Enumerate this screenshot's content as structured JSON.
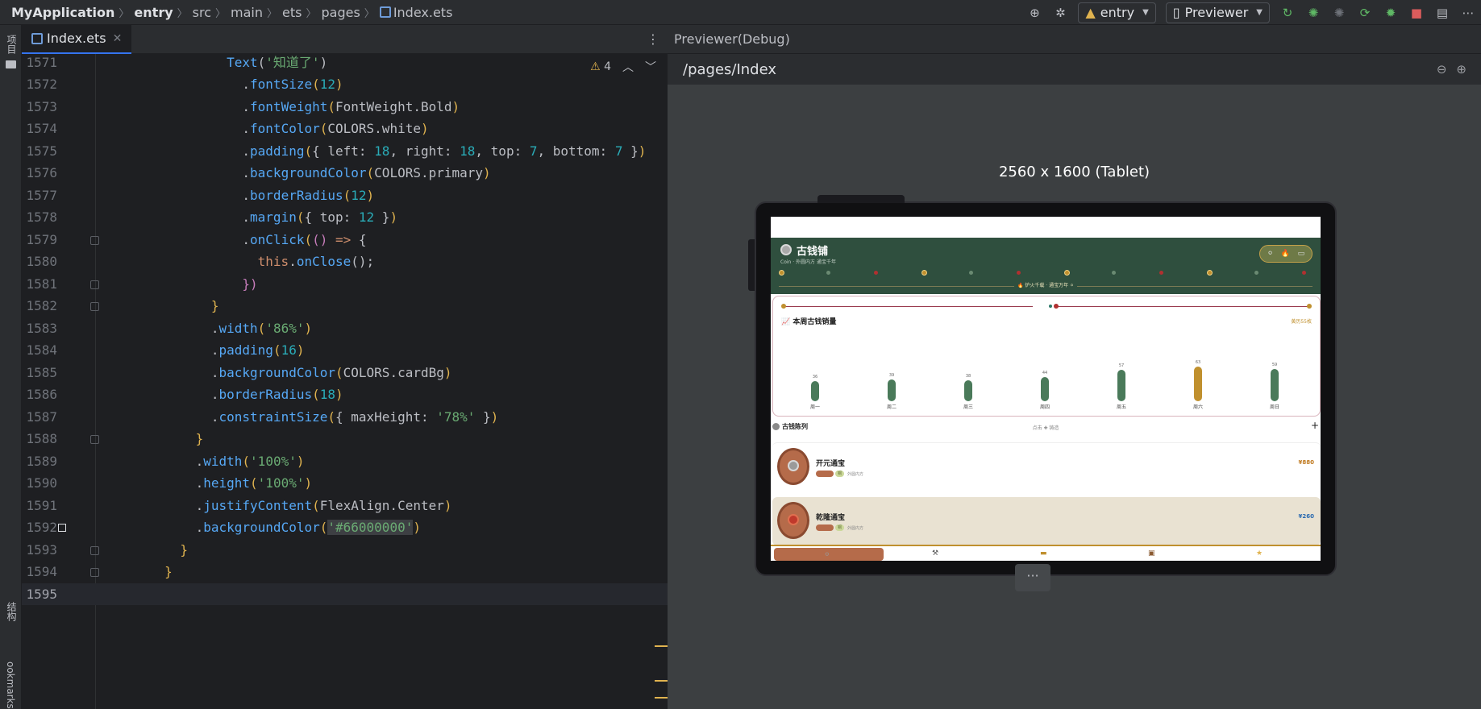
{
  "breadcrumb": [
    "MyApplication",
    "entry",
    "src",
    "main",
    "ets",
    "pages",
    "Index.ets"
  ],
  "toolbar": {
    "module_combo": "entry",
    "previewer_combo": "Previewer"
  },
  "left_strip": {
    "project_label": "项目",
    "structure_label": "结构",
    "bookmarks_label": "ookmarks"
  },
  "editor": {
    "tab_label": "Index.ets",
    "warning_count": "4",
    "lines": [
      {
        "n": "1571",
        "tokens": [
          [
            "w",
            "                "
          ],
          [
            "f",
            "Text"
          ],
          [
            "w",
            "("
          ],
          [
            "s",
            "'知道了'"
          ],
          [
            "w",
            ")"
          ]
        ]
      },
      {
        "n": "1572",
        "tokens": [
          [
            "w",
            "                  ."
          ],
          [
            "f",
            "fontSize"
          ],
          [
            "y",
            "("
          ],
          [
            "n",
            "12"
          ],
          [
            "y",
            ")"
          ]
        ]
      },
      {
        "n": "1573",
        "tokens": [
          [
            "w",
            "                  ."
          ],
          [
            "f",
            "fontWeight"
          ],
          [
            "y",
            "("
          ],
          [
            "w",
            "FontWeight.Bold"
          ],
          [
            "y",
            ")"
          ]
        ]
      },
      {
        "n": "1574",
        "tokens": [
          [
            "w",
            "                  ."
          ],
          [
            "f",
            "fontColor"
          ],
          [
            "y",
            "("
          ],
          [
            "w",
            "COLORS.white"
          ],
          [
            "y",
            ")"
          ]
        ]
      },
      {
        "n": "1575",
        "tokens": [
          [
            "w",
            "                  ."
          ],
          [
            "f",
            "padding"
          ],
          [
            "y",
            "("
          ],
          [
            "w",
            "{ left: "
          ],
          [
            "n",
            "18"
          ],
          [
            "w",
            ", right: "
          ],
          [
            "n",
            "18"
          ],
          [
            "w",
            ", top: "
          ],
          [
            "n",
            "7"
          ],
          [
            "w",
            ", bottom: "
          ],
          [
            "n",
            "7"
          ],
          [
            "w",
            " }"
          ],
          [
            "y",
            ")"
          ]
        ]
      },
      {
        "n": "1576",
        "tokens": [
          [
            "w",
            "                  ."
          ],
          [
            "f",
            "backgroundColor"
          ],
          [
            "y",
            "("
          ],
          [
            "w",
            "COLORS.primary"
          ],
          [
            "y",
            ")"
          ]
        ]
      },
      {
        "n": "1577",
        "tokens": [
          [
            "w",
            "                  ."
          ],
          [
            "f",
            "borderRadius"
          ],
          [
            "y",
            "("
          ],
          [
            "n",
            "12"
          ],
          [
            "y",
            ")"
          ]
        ]
      },
      {
        "n": "1578",
        "tokens": [
          [
            "w",
            "                  ."
          ],
          [
            "f",
            "margin"
          ],
          [
            "y",
            "("
          ],
          [
            "w",
            "{ top: "
          ],
          [
            "n",
            "12"
          ],
          [
            "w",
            " }"
          ],
          [
            "y",
            ")"
          ]
        ]
      },
      {
        "n": "1579",
        "tokens": [
          [
            "w",
            "                  ."
          ],
          [
            "f",
            "onClick"
          ],
          [
            "y",
            "("
          ],
          [
            "p",
            "()"
          ],
          [
            "w",
            " "
          ],
          [
            "k",
            "=>"
          ],
          [
            "w",
            " {"
          ]
        ]
      },
      {
        "n": "1580",
        "tokens": [
          [
            "w",
            "                    "
          ],
          [
            "k",
            "this"
          ],
          [
            "w",
            "."
          ],
          [
            "f",
            "onClose"
          ],
          [
            "w",
            "();"
          ]
        ]
      },
      {
        "n": "1581",
        "tokens": [
          [
            "w",
            "                  "
          ],
          [
            "p",
            "})"
          ]
        ]
      },
      {
        "n": "1582",
        "tokens": [
          [
            "w",
            "              "
          ],
          [
            "y",
            "}"
          ]
        ]
      },
      {
        "n": "1583",
        "tokens": [
          [
            "w",
            "              ."
          ],
          [
            "f",
            "width"
          ],
          [
            "y",
            "("
          ],
          [
            "s",
            "'86%'"
          ],
          [
            "y",
            ")"
          ]
        ]
      },
      {
        "n": "1584",
        "tokens": [
          [
            "w",
            "              ."
          ],
          [
            "f",
            "padding"
          ],
          [
            "y",
            "("
          ],
          [
            "n",
            "16"
          ],
          [
            "y",
            ")"
          ]
        ]
      },
      {
        "n": "1585",
        "tokens": [
          [
            "w",
            "              ."
          ],
          [
            "f",
            "backgroundColor"
          ],
          [
            "y",
            "("
          ],
          [
            "w",
            "COLORS.cardBg"
          ],
          [
            "y",
            ")"
          ]
        ]
      },
      {
        "n": "1586",
        "tokens": [
          [
            "w",
            "              ."
          ],
          [
            "f",
            "borderRadius"
          ],
          [
            "y",
            "("
          ],
          [
            "n",
            "18"
          ],
          [
            "y",
            ")"
          ]
        ]
      },
      {
        "n": "1587",
        "tokens": [
          [
            "w",
            "              ."
          ],
          [
            "f",
            "constraintSize"
          ],
          [
            "y",
            "("
          ],
          [
            "w",
            "{ maxHeight: "
          ],
          [
            "s",
            "'78%'"
          ],
          [
            "w",
            " }"
          ],
          [
            "y",
            ")"
          ]
        ]
      },
      {
        "n": "1588",
        "tokens": [
          [
            "w",
            "            "
          ],
          [
            "y",
            "}"
          ]
        ]
      },
      {
        "n": "1589",
        "tokens": [
          [
            "w",
            "            ."
          ],
          [
            "f",
            "width"
          ],
          [
            "y",
            "("
          ],
          [
            "s",
            "'100%'"
          ],
          [
            "y",
            ")"
          ]
        ]
      },
      {
        "n": "1590",
        "tokens": [
          [
            "w",
            "            ."
          ],
          [
            "f",
            "height"
          ],
          [
            "y",
            "("
          ],
          [
            "s",
            "'100%'"
          ],
          [
            "y",
            ")"
          ]
        ]
      },
      {
        "n": "1591",
        "tokens": [
          [
            "w",
            "            ."
          ],
          [
            "f",
            "justifyContent"
          ],
          [
            "y",
            "("
          ],
          [
            "w",
            "FlexAlign.Center"
          ],
          [
            "y",
            ")"
          ]
        ]
      },
      {
        "n": "1592",
        "tokens": [
          [
            "w",
            "            ."
          ],
          [
            "f",
            "backgroundColor"
          ],
          [
            "y",
            "("
          ],
          [
            "s",
            "'#66000000'"
          ],
          [
            "y",
            ")"
          ]
        ]
      },
      {
        "n": "1593",
        "tokens": [
          [
            "w",
            "          "
          ],
          [
            "y",
            "}"
          ]
        ]
      },
      {
        "n": "1594",
        "tokens": [
          [
            "w",
            "        "
          ],
          [
            "y",
            "}"
          ]
        ]
      },
      {
        "n": "1595",
        "tokens": [
          [
            "w",
            ""
          ]
        ]
      }
    ]
  },
  "previewer": {
    "header": "Previewer(Debug)",
    "route": "/pages/Index",
    "device_label": "2560 x 1600 (Tablet)",
    "app": {
      "title": "古钱铺",
      "subtitle": "Coin · 外圆内方 通宝千年",
      "center_caption": "🔥 炉火千载 · 通宝万年 ⚪",
      "chart_title": "📈 本周古钱销量",
      "chart_right": "黄历55枚",
      "section_title": "古钱陈列",
      "section_middle": "点击 ✚ 铸造",
      "section_plus": "+",
      "items": [
        {
          "name": "开元通宝",
          "tag": "铜",
          "desc": "外圆内方",
          "price": "¥880",
          "price_color": "#c07a20",
          "bg": "#ffffff"
        },
        {
          "name": "乾隆通宝",
          "tag": "铜",
          "desc": "外圆内方",
          "price": "¥260",
          "price_color": "#2a6ab0",
          "bg": "#e9e2d2"
        }
      ]
    },
    "more_label": "···"
  },
  "chart_data": {
    "type": "bar",
    "title": "本周古钱销量",
    "categories": [
      "周一",
      "周二",
      "周三",
      "周四",
      "周五",
      "周六",
      "周日"
    ],
    "values": [
      36,
      39,
      38,
      44,
      57,
      63,
      59
    ],
    "highlight_index": 5,
    "colors": {
      "bar": "#4a7a5a",
      "highlight": "#c0902e"
    }
  },
  "colors": {
    "accent": "#3574f0",
    "header_green": "#2f4f3e",
    "gold": "#c0902e",
    "red": "#b03030"
  }
}
